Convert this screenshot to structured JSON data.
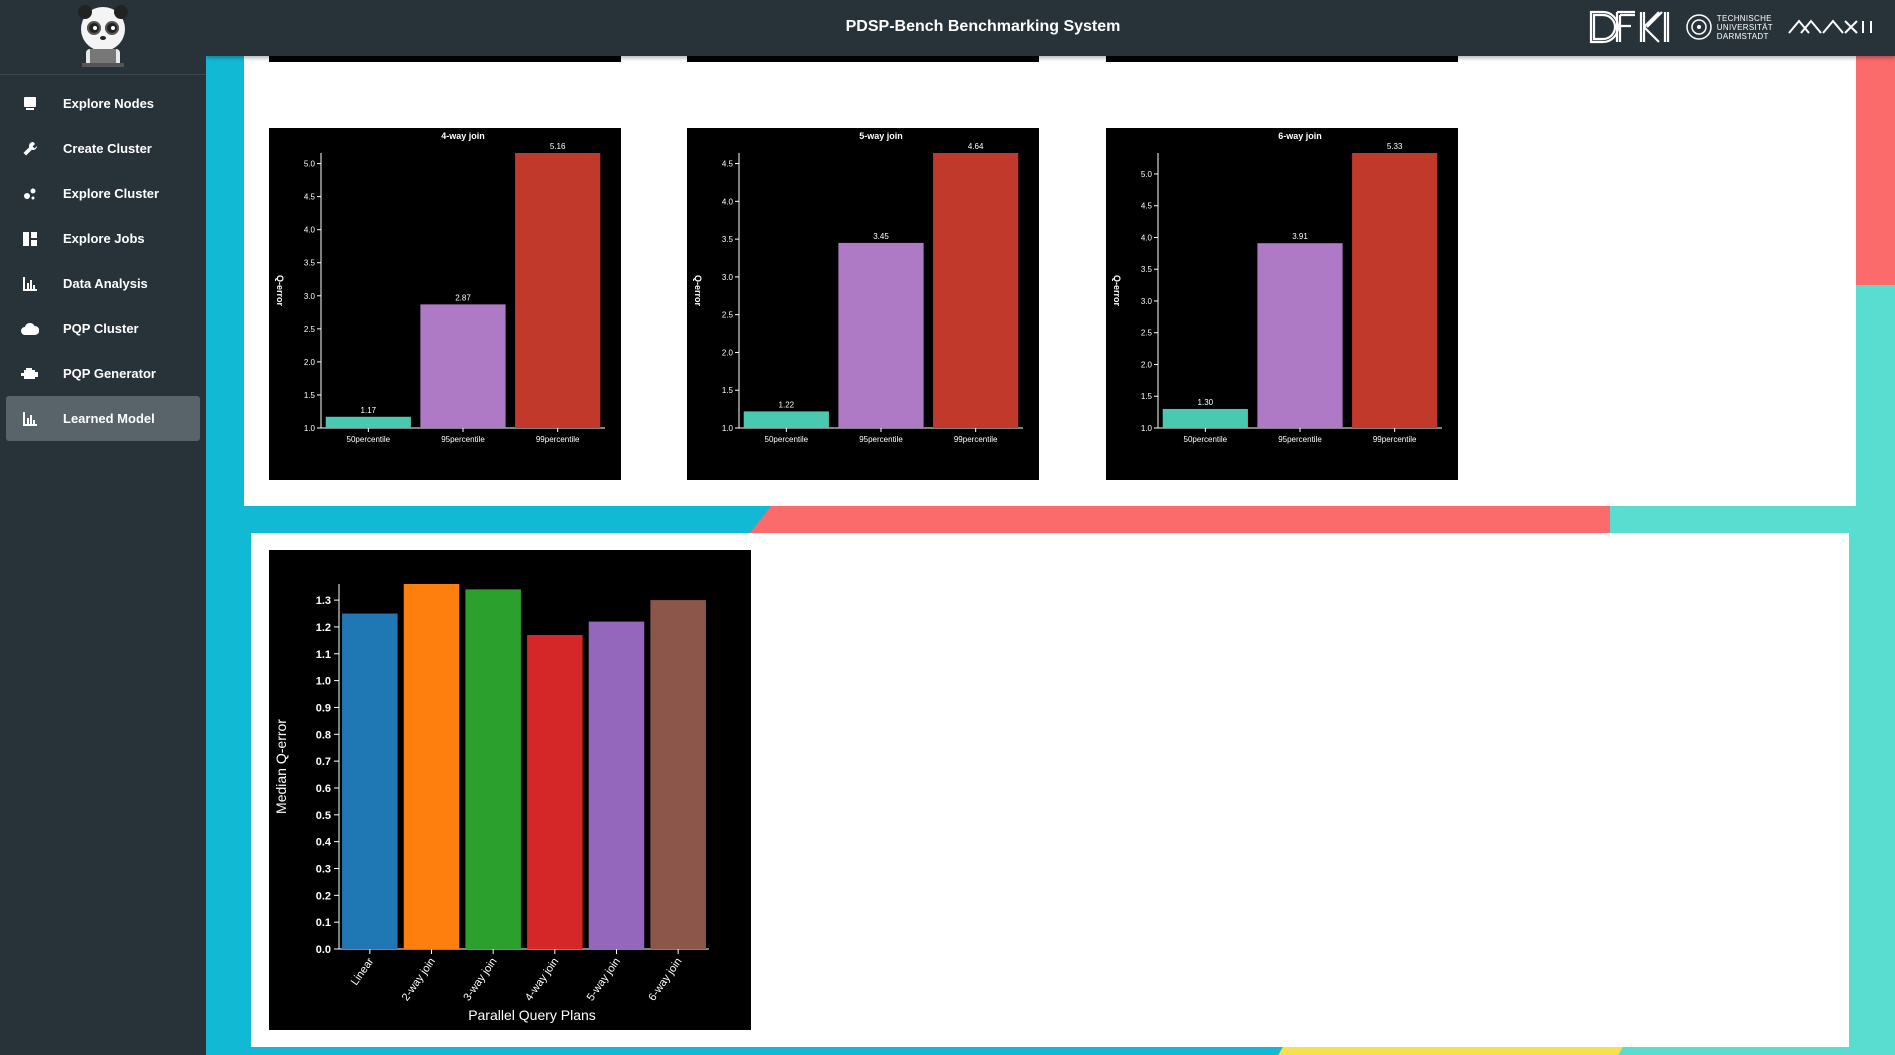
{
  "app": {
    "title": "PDSP-Bench Benchmarking System",
    "logos": [
      "DFKI",
      "TECHNISCHE UNIVERSITÄT DARMSTADT",
      "MAXI"
    ],
    "tu_text": [
      "TECHNISCHE",
      "UNIVERSITÄT",
      "DARMSTADT"
    ]
  },
  "sidebar": {
    "items": [
      {
        "label": "Explore Nodes",
        "icon": "monitor-icon"
      },
      {
        "label": "Create Cluster",
        "icon": "wrench-icon"
      },
      {
        "label": "Explore Cluster",
        "icon": "bubbles-icon"
      },
      {
        "label": "Explore Jobs",
        "icon": "dashboard-icon"
      },
      {
        "label": "Data Analysis",
        "icon": "bar-chart-icon"
      },
      {
        "label": "PQP Cluster",
        "icon": "cloud-icon"
      },
      {
        "label": "PQP Generator",
        "icon": "engine-icon"
      },
      {
        "label": "Learned Model",
        "icon": "bar-chart-icon",
        "active": true
      }
    ]
  },
  "colors": {
    "p50": "#48c9b0",
    "p95": "#af7ac5",
    "p99": "#c0392b"
  },
  "chart_data": [
    {
      "type": "bar",
      "title": "4-way join",
      "ylabel": "Q-error",
      "categories": [
        "50percentile",
        "95percentile",
        "99percentile"
      ],
      "values": [
        1.17,
        2.87,
        5.16
      ],
      "value_labels": [
        "1.17",
        "2.87",
        "5.16"
      ],
      "ylim": [
        1.0,
        5.16
      ],
      "yticks": [
        "1.0",
        "1.5",
        "2.0",
        "2.5",
        "3.0",
        "3.5",
        "4.0",
        "4.5",
        "5.0"
      ]
    },
    {
      "type": "bar",
      "title": "5-way join",
      "ylabel": "Q-error",
      "categories": [
        "50percentile",
        "95percentile",
        "99percentile"
      ],
      "values": [
        1.22,
        3.45,
        4.64
      ],
      "value_labels": [
        "1.22",
        "3.45",
        "4.64"
      ],
      "ylim": [
        1.0,
        4.64
      ],
      "yticks": [
        "1.0",
        "1.5",
        "2.0",
        "2.5",
        "3.0",
        "3.5",
        "4.0",
        "4.5"
      ]
    },
    {
      "type": "bar",
      "title": "6-way join",
      "ylabel": "Q-error",
      "categories": [
        "50percentile",
        "95percentile",
        "99percentile"
      ],
      "values": [
        1.3,
        3.91,
        5.33
      ],
      "value_labels": [
        "1.30",
        "3.91",
        "5.33"
      ],
      "ylim": [
        1.0,
        5.33
      ],
      "yticks": [
        "1.0",
        "1.5",
        "2.0",
        "2.5",
        "3.0",
        "3.5",
        "4.0",
        "4.5",
        "5.0"
      ]
    },
    {
      "type": "bar",
      "title": "",
      "xlabel": "Parallel Query Plans",
      "ylabel": "Median Q-error",
      "categories": [
        "Linear",
        "2-way join",
        "3-way join",
        "4-way join",
        "5-way join",
        "6-way join"
      ],
      "values": [
        1.25,
        1.36,
        1.34,
        1.17,
        1.22,
        1.3
      ],
      "colors": [
        "#1f77b4",
        "#ff7f0e",
        "#2ca02c",
        "#d62728",
        "#9467bd",
        "#8c564b"
      ],
      "ylim": [
        0.0,
        1.36
      ],
      "yticks": [
        "0.0",
        "0.1",
        "0.2",
        "0.3",
        "0.4",
        "0.5",
        "0.6",
        "0.7",
        "0.8",
        "0.9",
        "1.0",
        "1.1",
        "1.2",
        "1.3"
      ]
    }
  ]
}
